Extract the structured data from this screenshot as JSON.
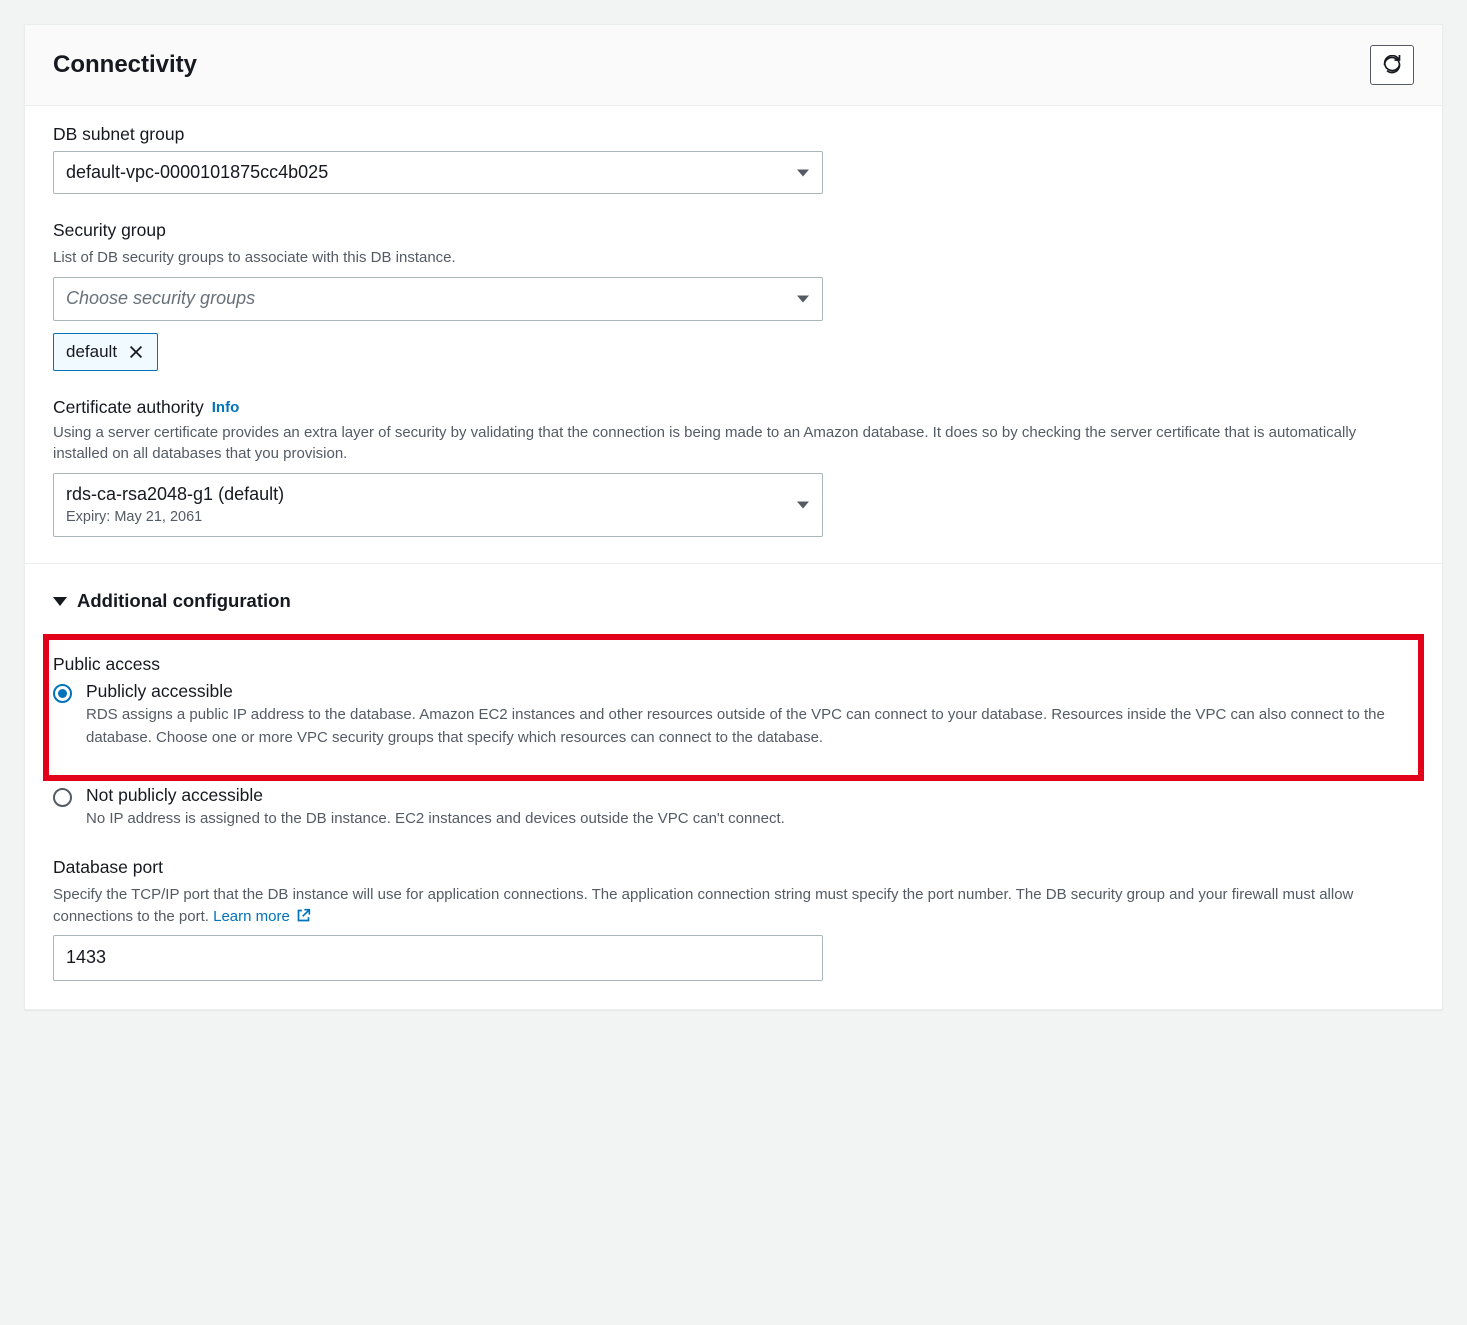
{
  "panel": {
    "title": "Connectivity"
  },
  "subnet": {
    "label": "DB subnet group",
    "value": "default-vpc-0000101875cc4b025"
  },
  "security": {
    "label": "Security group",
    "desc": "List of DB security groups to associate with this DB instance.",
    "placeholder": "Choose security groups",
    "tag": "default"
  },
  "cert": {
    "label": "Certificate authority",
    "info": "Info",
    "desc": "Using a server certificate provides an extra layer of security by validating that the connection is being made to an Amazon database. It does so by checking the server certificate that is automatically installed on all databases that you provision.",
    "value": "rds-ca-rsa2048-g1 (default)",
    "expiry": "Expiry: May 21, 2061"
  },
  "addl": {
    "header": "Additional configuration"
  },
  "public": {
    "label": "Public access",
    "opt1_label": "Publicly accessible",
    "opt1_desc": "RDS assigns a public IP address to the database. Amazon EC2 instances and other resources outside of the VPC can connect to your database. Resources inside the VPC can also connect to the database. Choose one or more VPC security groups that specify which resources can connect to the database.",
    "opt2_label": "Not publicly accessible",
    "opt2_desc": "No IP address is assigned to the DB instance. EC2 instances and devices outside the VPC can't connect."
  },
  "port": {
    "label": "Database port",
    "desc": "Specify the TCP/IP port that the DB instance will use for application connections. The application connection string must specify the port number. The DB security group and your firewall must allow connections to the port. ",
    "learn": "Learn more",
    "value": "1433"
  }
}
